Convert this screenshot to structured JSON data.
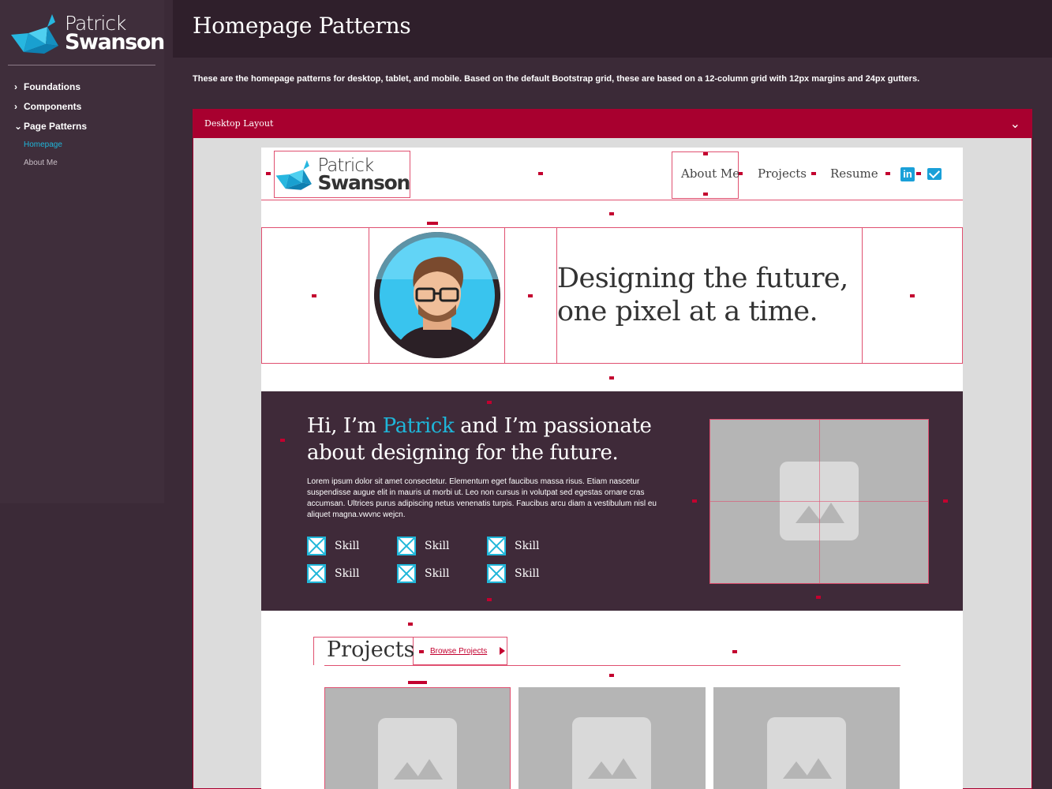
{
  "brand": {
    "name_line1": "Patrick",
    "name_line2": "Swanson"
  },
  "sidebar": {
    "items": [
      {
        "label": "Foundations",
        "expanded": false
      },
      {
        "label": "Components",
        "expanded": false
      },
      {
        "label": "Page Patterns",
        "expanded": true
      }
    ],
    "subitems": [
      {
        "label": "Homepage",
        "active": true
      },
      {
        "label": "About Me",
        "active": false
      }
    ]
  },
  "page": {
    "title": "Homepage Patterns",
    "intro": "These are the homepage patterns for desktop, tablet, and mobile. Based on the default Bootstrap grid, these are based on a 12-column grid with 12px margins and 24px gutters."
  },
  "panel": {
    "label": "Desktop Layout",
    "icon": "chevron-down-icon"
  },
  "mockup": {
    "nav": [
      "About Me",
      "Projects",
      "Resume"
    ],
    "hero": {
      "line1": "Designing the future,",
      "line2": "one pixel at a time."
    },
    "about": {
      "pre": "Hi, I’m ",
      "accent": "Patrick",
      "post": " and I’m passionate",
      "line2": "about designing for the future.",
      "body": "Lorem ipsum dolor sit amet consectetur. Elementum eget faucibus massa risus. Etiam nascetur suspendisse augue elit in mauris ut morbi ut. Leo non cursus in volutpat sed egestas ornare cras accumsan. Ultrices purus adipiscing netus venenatis turpis. Faucibus arcu diam a vestibulum nisl eu aliquet magna.vwvnc wejcn.",
      "skills": [
        "Skill",
        "Skill",
        "Skill",
        "Skill",
        "Skill",
        "Skill"
      ]
    },
    "projects": {
      "heading": "Projects",
      "browse": "Browse Projects"
    }
  },
  "colors": {
    "accent": "#1fb6d9",
    "brand_red": "#a8002f",
    "dark": "#3f2a39"
  }
}
